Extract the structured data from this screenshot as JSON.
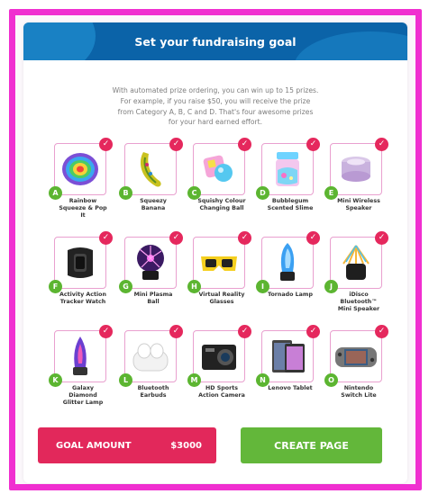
{
  "header": {
    "title": "Set your fundraising goal"
  },
  "intro": {
    "lines": [
      "With automated prize ordering, you can win up to 15 prizes.",
      "For example, if you raise $50, you will receive the prize",
      "from Category A, B, C and D. That's four awesome prizes",
      "for your hard earned effort."
    ]
  },
  "prizes": [
    {
      "letter": "A",
      "name": "Rainbow Squeeze & Pop It",
      "icon": "pop-it-icon"
    },
    {
      "letter": "B",
      "name": "Squeezy Banana",
      "icon": "banana-icon"
    },
    {
      "letter": "C",
      "name": "Squishy Colour Changing Ball",
      "icon": "ball-icon"
    },
    {
      "letter": "D",
      "name": "Bubblegum Scented Slime",
      "icon": "slime-jar-icon"
    },
    {
      "letter": "E",
      "name": "Mini Wireless Speaker",
      "icon": "speaker-icon"
    },
    {
      "letter": "F",
      "name": "Activity Action Tracker Watch",
      "icon": "watch-icon"
    },
    {
      "letter": "G",
      "name": "Mini Plasma Ball",
      "icon": "plasma-ball-icon"
    },
    {
      "letter": "H",
      "name": "Virtual Reality Glasses",
      "icon": "vr-glasses-icon"
    },
    {
      "letter": "I",
      "name": "Tornado Lamp",
      "icon": "tornado-lamp-icon"
    },
    {
      "letter": "J",
      "name": "iDisco Bluetooth™ Mini Speaker",
      "icon": "disco-speaker-icon"
    },
    {
      "letter": "K",
      "name": "Galaxy Diamond Glitter Lamp",
      "icon": "glitter-lamp-icon"
    },
    {
      "letter": "L",
      "name": "Bluetooth Earbuds",
      "icon": "earbuds-icon"
    },
    {
      "letter": "M",
      "name": "HD Sports Action Camera",
      "icon": "camera-icon"
    },
    {
      "letter": "N",
      "name": "Lenovo Tablet",
      "icon": "tablet-icon"
    },
    {
      "letter": "O",
      "name": "Nintendo Switch Lite",
      "icon": "switch-icon"
    }
  ],
  "check_glyph": "✓",
  "goal": {
    "label": "GOAL AMOUNT",
    "amount": "$3000"
  },
  "create": {
    "label": "CREATE PAGE"
  },
  "colors": {
    "frame": "#f02fd0",
    "header": "#0b63a8",
    "check": "#e5285d",
    "letter_badge": "#5cb531",
    "goal_button": "#e2285b",
    "create_button": "#63b73a"
  }
}
